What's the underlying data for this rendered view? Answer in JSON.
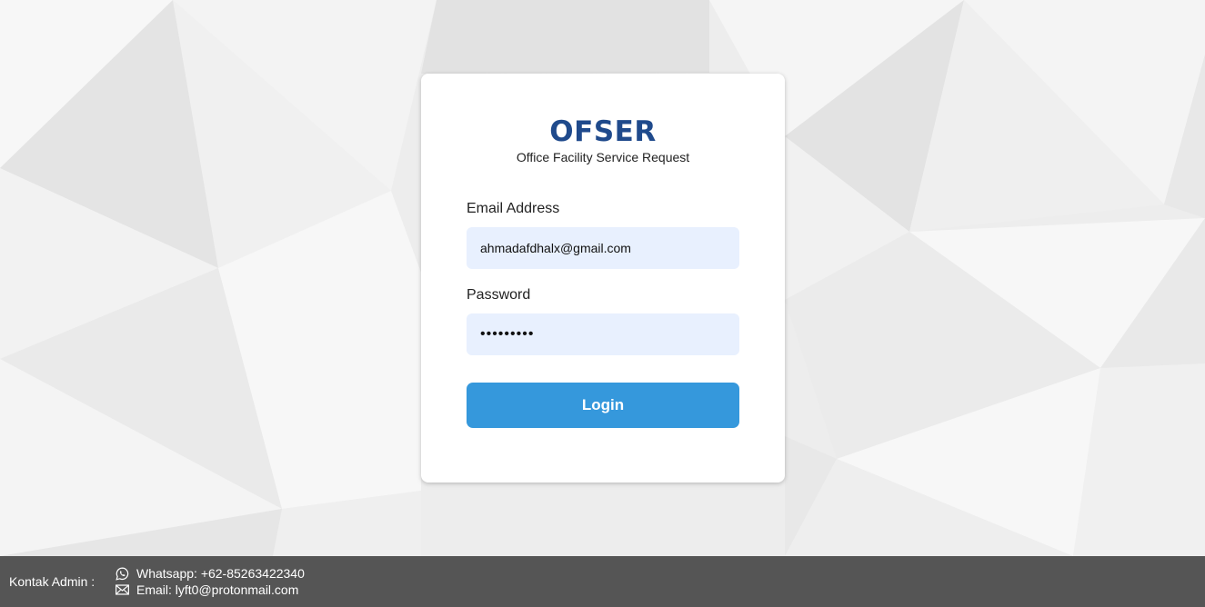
{
  "login_card": {
    "brand": "OFSER",
    "subtitle": "Office Facility Service Request",
    "email_label": "Email Address",
    "email_value": "ahmadafdhalx@gmail.com",
    "password_label": "Password",
    "password_value": "•••••••••",
    "login_button": "Login"
  },
  "footer": {
    "label": "Kontak Admin :",
    "whatsapp": "Whatsapp: +62-85263422340",
    "email": "Email: lyft0@protonmail.com",
    "whatsapp_icon": "whatsapp-icon",
    "email_icon": "envelope-icon"
  },
  "colors": {
    "brand": "#1f4a8c",
    "button": "#3598dc",
    "input_bg": "#e8f0fe",
    "footer_bg": "#555555"
  }
}
